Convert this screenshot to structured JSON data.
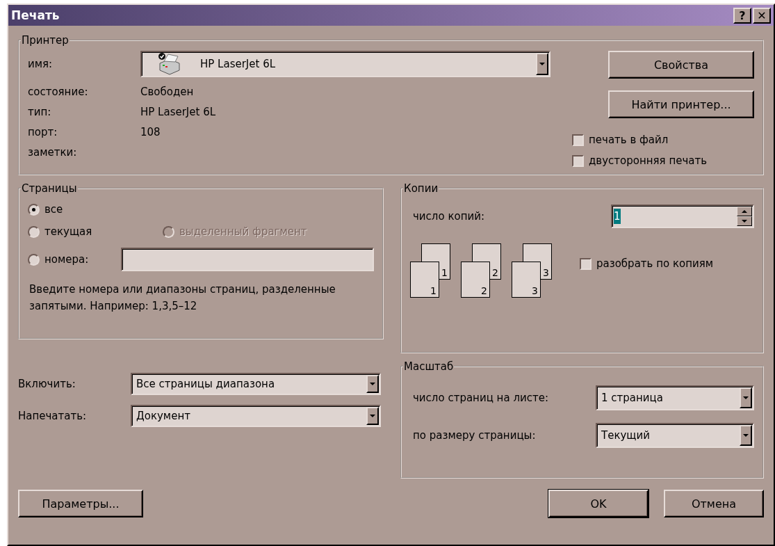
{
  "window": {
    "title": "Печать",
    "help_button": "?",
    "close_button": "✕"
  },
  "printer": {
    "legend": "Принтер",
    "name_label": "имя:",
    "name_value": "HP LaserJet 6L",
    "info": [
      {
        "label": "состояние:",
        "value": "Свободен"
      },
      {
        "label": "тип:",
        "value": "HP LaserJet 6L"
      },
      {
        "label": "порт:",
        "value": "108"
      },
      {
        "label": "заметки:"
      }
    ],
    "buttons": [
      "Свойства",
      "Найти принтер..."
    ],
    "options": [
      {
        "label": "печать в файл",
        "checked": false
      },
      {
        "label": "двусторонняя печать",
        "checked": false
      }
    ]
  },
  "pages": {
    "legend": "Страницы",
    "options": [
      {
        "label": "все",
        "selected": true,
        "disabled": false
      },
      {
        "label": "текущая",
        "selected": false,
        "disabled": false
      },
      {
        "label": "выделенный фрагмент",
        "selected": false,
        "disabled": true
      },
      {
        "label": "номера:",
        "selected": false,
        "disabled": false
      }
    ],
    "hint": "Введите номера или диапазоны страниц, разделенные запятыми. Например: 1,3,5–12"
  },
  "copies": {
    "legend": "Копии",
    "count_label": "число копий:",
    "count_value": "1",
    "stacks": [
      {
        "back": "1",
        "front": "1"
      },
      {
        "back": "2",
        "front": "2"
      },
      {
        "back": "3",
        "front": "3"
      }
    ],
    "collate": {
      "label": "разобрать по копиям",
      "checked": false
    }
  },
  "include": [
    {
      "label": "Включить:",
      "value": "Все страницы диапазона"
    },
    {
      "label": "Напечатать:",
      "value": "Документ"
    }
  ],
  "scale": {
    "legend": "Масштаб",
    "rows": [
      {
        "label": "число страниц на листе:",
        "value": "1 страница"
      },
      {
        "label": "по размеру страницы:",
        "value": "Текущий"
      }
    ]
  },
  "buttons": [
    {
      "label": "Параметры...",
      "default": false
    },
    {
      "label": "OK",
      "default": true
    },
    {
      "label": "Отмена",
      "default": false
    }
  ]
}
